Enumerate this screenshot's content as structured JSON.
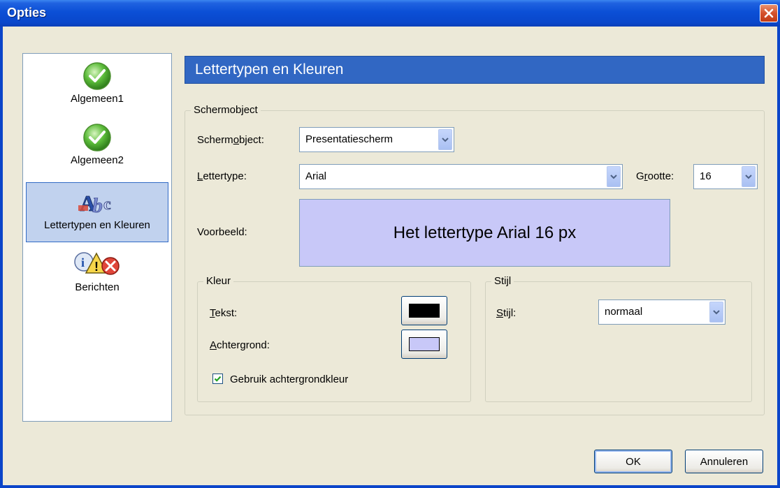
{
  "window": {
    "title": "Opties"
  },
  "sidebar": {
    "items": [
      {
        "label": "Algemeen1",
        "icon": "check-icon"
      },
      {
        "label": "Algemeen2",
        "icon": "check-icon"
      },
      {
        "label": "Lettertypen en Kleuren",
        "icon": "fonts-icon",
        "selected": true
      },
      {
        "label": "Berichten",
        "icon": "messages-icon"
      }
    ]
  },
  "header": {
    "title": "Lettertypen en Kleuren"
  },
  "screen_object_group": {
    "legend": "Schermobject",
    "screen_object_label_pre": "Scherm",
    "screen_object_label_u": "o",
    "screen_object_label_post": "bject:",
    "screen_object_value": "Presentatiescherm",
    "font_label_u": "L",
    "font_label_post": "ettertype:",
    "font_value": "Arial",
    "size_label_pre": "G",
    "size_label_u": "r",
    "size_label_post": "ootte:",
    "size_value": "16",
    "preview_label": "Voorbeeld:",
    "preview_text": "Het lettertype Arial 16 px"
  },
  "color_group": {
    "legend": "Kleur",
    "text_label_u": "T",
    "text_label_post": "ekst:",
    "background_label_u": "A",
    "background_label_post": "chtergrond:",
    "use_bg_label": "Gebruik achtergrondkleur",
    "use_bg_checked": true,
    "text_color": "#000000",
    "background_color": "#c8c8f8"
  },
  "style_group": {
    "legend": "Stijl",
    "style_label_u": "S",
    "style_label_post": "tijl:",
    "style_value": "normaal"
  },
  "buttons": {
    "ok": "OK",
    "cancel": "Annuleren"
  }
}
